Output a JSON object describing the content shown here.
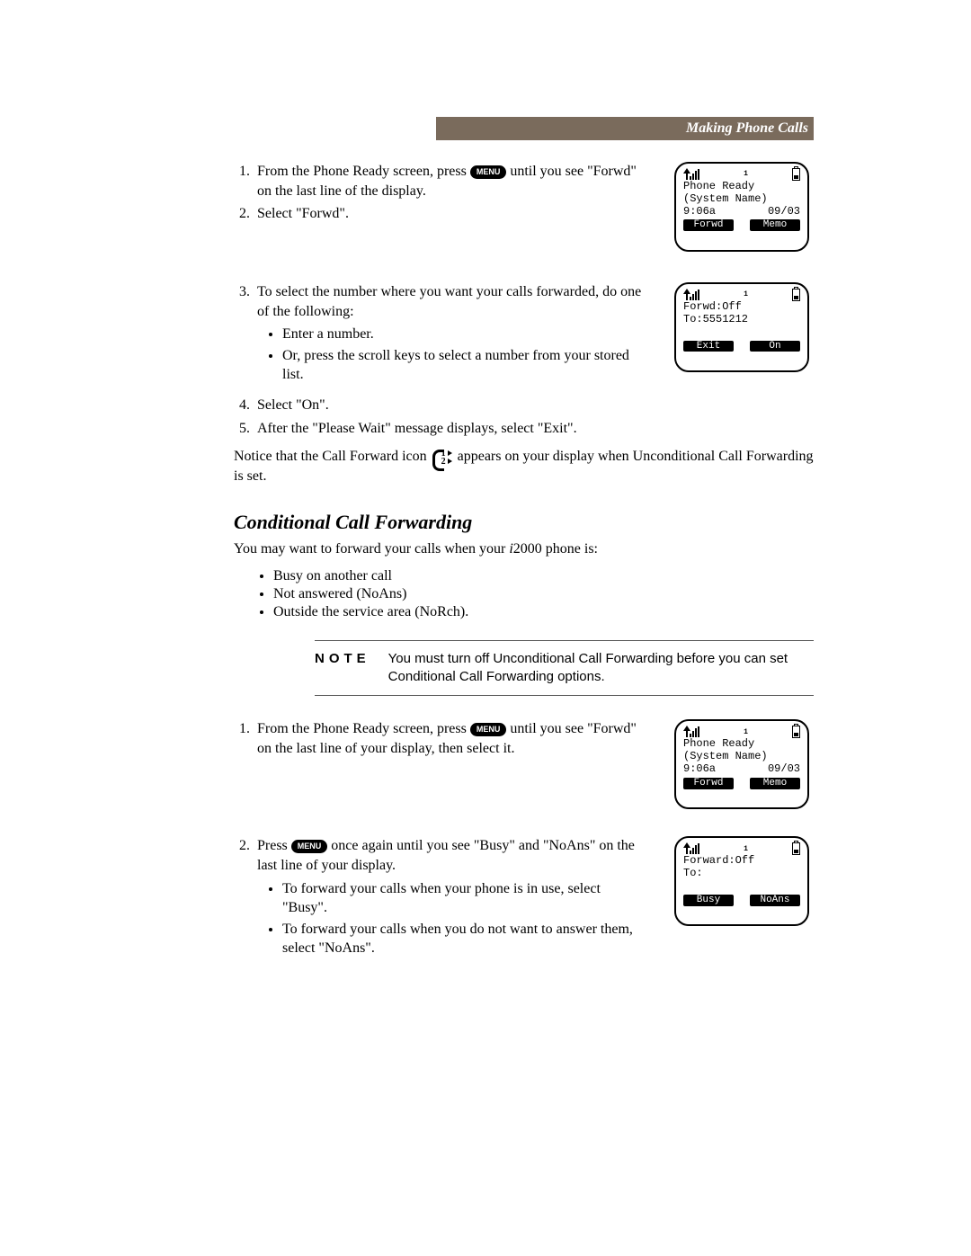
{
  "header": {
    "title": "Making Phone Calls"
  },
  "menu_label": "MENU",
  "section1": {
    "steps": {
      "s1a": "From the Phone Ready screen, press ",
      "s1b": " until you see \"Forwd\" on the last line of the display.",
      "s2": "Select \"Forwd\".",
      "s3": "To select the number where you want your calls forwarded, do one of the following:",
      "s3_b1": "Enter a number.",
      "s3_b2": "Or, press the scroll keys to select a number from your stored list.",
      "s4": "Select \"On\".",
      "s5": "After the \"Please Wait\" message displays, select \"Exit\"."
    },
    "notice_a": "Notice that the Call Forward icon ",
    "notice_b": " appears on your display when Unconditional Call Forwarding is set."
  },
  "screen1": {
    "top_num": "1",
    "l1": "Phone Ready",
    "l2": "(System Name)",
    "l3a": "9:06a",
    "l3b": "09/03",
    "sk_left": "Forwd",
    "sk_right": "Memo"
  },
  "screen2": {
    "top_num": "1",
    "l1": "Forwd:Off",
    "l2": "To:5551212",
    "sk_left": "Exit",
    "sk_right": "On"
  },
  "cond": {
    "heading": "Conditional Call Forwarding",
    "intro_a": "You may want to forward your calls when your ",
    "intro_model": "i",
    "intro_model_num": "2000",
    "intro_b": " phone is:",
    "b1": "Busy on another call",
    "b2": "Not answered (NoAns)",
    "b3": "Outside the service area (NoRch)."
  },
  "note": {
    "label": "NOTE",
    "text": "You must turn off Unconditional Call Forwarding before you can set Conditional Call Forwarding options."
  },
  "section2": {
    "s1a": "From the Phone Ready screen, press ",
    "s1b": " until you see \"Forwd\" on the last line of your display, then select it.",
    "s2a": "Press ",
    "s2b": " once again until you see \"Busy\" and \"NoAns\" on the last line of your display.",
    "s2_b1": "To forward your calls when your phone is in use, select \"Busy\".",
    "s2_b2": "To forward your calls when you do not want to answer them, select \"NoAns\"."
  },
  "screen3": {
    "top_num": "1",
    "l1": "Phone Ready",
    "l2": "(System Name)",
    "l3a": "9:06a",
    "l3b": "09/03",
    "sk_left": "Forwd",
    "sk_right": "Memo"
  },
  "screen4": {
    "top_num": "1",
    "l1": "Forward:Off",
    "l2": "To:",
    "sk_left": "Busy",
    "sk_right": "NoAns"
  }
}
